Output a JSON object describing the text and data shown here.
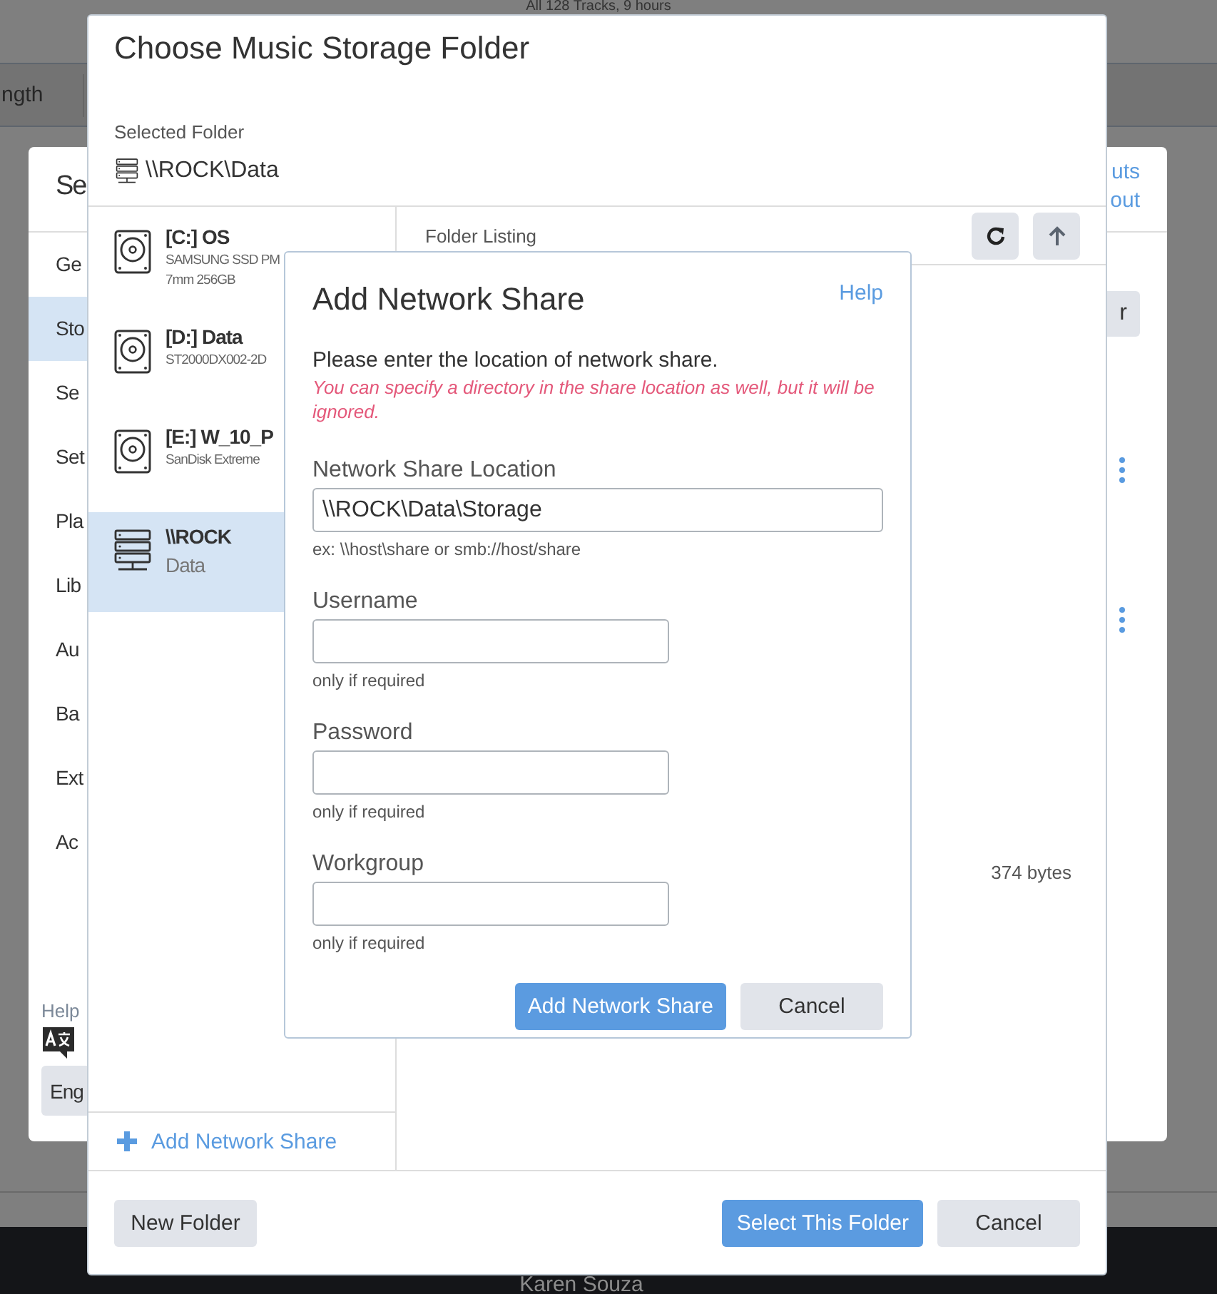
{
  "background": {
    "summary": "All 128 Tracks, 9 hours",
    "column_header": "ngth",
    "footer_text": "Karen Souza"
  },
  "settings_dialog": {
    "title": "Se",
    "links": [
      "uts",
      "out"
    ],
    "button": "r",
    "nav_items": [
      {
        "label": "Ge",
        "selected": false
      },
      {
        "label": "Sto",
        "selected": true
      },
      {
        "label": "Se",
        "selected": false
      },
      {
        "label": "Set",
        "selected": false
      },
      {
        "label": "Pla",
        "selected": false
      },
      {
        "label": "Lib",
        "selected": false
      },
      {
        "label": "Au",
        "selected": false
      },
      {
        "label": "Ba",
        "selected": false
      },
      {
        "label": "Ext",
        "selected": false
      },
      {
        "label": "Ac",
        "selected": false
      }
    ],
    "help_label": "Help",
    "language_button": "Eng"
  },
  "folder_dialog": {
    "title": "Choose Music Storage Folder",
    "selected_folder_label": "Selected Folder",
    "selected_folder": "\\\\ROCK\\Data",
    "locations": [
      {
        "kind": "drive",
        "name": "[C:] OS",
        "details": [
          "SAMSUNG SSD PM",
          "7mm 256GB"
        ],
        "selected": false
      },
      {
        "kind": "drive",
        "name": "[D:] Data",
        "details": [
          "ST2000DX002-2D"
        ],
        "selected": false
      },
      {
        "kind": "drive",
        "name": "[E:] W_10_P",
        "details": [
          "SanDisk Extreme"
        ],
        "selected": false
      },
      {
        "kind": "network",
        "name": "\\\\ROCK",
        "details": [
          "Data"
        ],
        "selected": true
      }
    ],
    "add_network_share": "Add Network Share",
    "listing_label": "Folder Listing",
    "file_size": "374 bytes",
    "buttons": [
      {
        "label": "New Folder",
        "kind": "secondary"
      },
      {
        "label": "Select This Folder",
        "kind": "primary"
      },
      {
        "label": "Cancel",
        "kind": "secondary"
      }
    ]
  },
  "network_share_dialog": {
    "title": "Add Network Share",
    "help": "Help",
    "intro": "Please enter the location of network share.",
    "note": "You can specify a directory in the share location as well, but it will be ignored.",
    "fields": [
      {
        "kind": "location",
        "label": "Network Share Location",
        "value": "\\\\ROCK\\Data\\Storage",
        "hint": "ex: \\\\host\\share or smb://host/share"
      },
      {
        "kind": "optional",
        "label": "Username",
        "hint": "only if required"
      },
      {
        "kind": "optional",
        "label": "Password",
        "hint": "only if required"
      },
      {
        "kind": "optional",
        "label": "Workgroup",
        "hint": "only if required"
      }
    ],
    "buttons": [
      {
        "label": "Add Network Share",
        "kind": "primary"
      },
      {
        "label": "Cancel",
        "kind": "secondary"
      }
    ]
  }
}
